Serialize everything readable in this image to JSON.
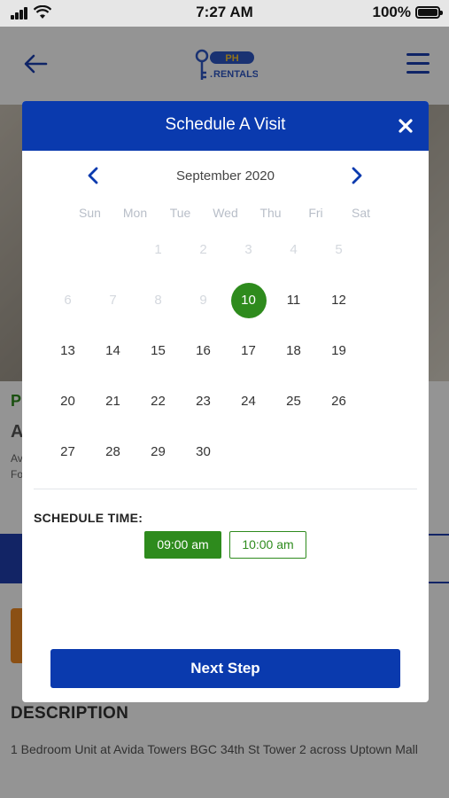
{
  "status_bar": {
    "time": "7:27 AM",
    "battery": "100%"
  },
  "app": {
    "logo_text_top": "PH",
    "logo_text_bottom": "RENTALS"
  },
  "background": {
    "price_initial": "P",
    "title_initial": "A",
    "subtitle_1": "Av",
    "subtitle_2": "Fo",
    "description_title": "DESCRIPTION",
    "description_text": "1 Bedroom Unit at Avida Towers BGC 34th St Tower 2 across Uptown Mall"
  },
  "modal": {
    "title": "Schedule A Visit",
    "month": "September 2020",
    "weekdays": [
      "Sun",
      "Mon",
      "Tue",
      "Wed",
      "Thu",
      "Fri",
      "Sat"
    ],
    "weeks": [
      [
        {
          "d": ""
        },
        {
          "d": ""
        },
        {
          "d": ""
        },
        {
          "d": ""
        },
        {
          "d": "1",
          "dim": true
        },
        {
          "d": "2",
          "dim": true
        },
        {
          "d": "3",
          "dim": true
        },
        {
          "d": "4",
          "dim": true
        },
        {
          "d": "5",
          "dim": true
        }
      ],
      [
        {
          "d": "6",
          "dim": true
        },
        {
          "d": "7",
          "dim": true
        },
        {
          "d": "8",
          "dim": true
        },
        {
          "d": "9",
          "dim": true
        },
        {
          "d": "10",
          "selected": true
        },
        {
          "d": "11"
        },
        {
          "d": "12"
        }
      ],
      [
        {
          "d": "13"
        },
        {
          "d": "14"
        },
        {
          "d": "15"
        },
        {
          "d": "16"
        },
        {
          "d": "17"
        },
        {
          "d": "18"
        },
        {
          "d": "19"
        }
      ],
      [
        {
          "d": "20"
        },
        {
          "d": "21"
        },
        {
          "d": "22"
        },
        {
          "d": "23"
        },
        {
          "d": "24"
        },
        {
          "d": "25"
        },
        {
          "d": "26"
        }
      ],
      [
        {
          "d": "27"
        },
        {
          "d": "28"
        },
        {
          "d": "29"
        },
        {
          "d": "30"
        }
      ]
    ],
    "schedule_label": "SCHEDULE TIME:",
    "time_slots": [
      {
        "label": "09:00 am",
        "selected": true
      },
      {
        "label": "10:00 am",
        "selected": false
      }
    ],
    "next_button": "Next Step"
  },
  "colors": {
    "primary": "#0a3aae",
    "accent_green": "#2e8b1d",
    "orange": "#f08a24"
  },
  "icons": {
    "back": "arrow-left-icon",
    "menu": "hamburger-icon",
    "close": "close-icon",
    "prev": "chevron-left-icon",
    "next": "chevron-right-icon"
  }
}
